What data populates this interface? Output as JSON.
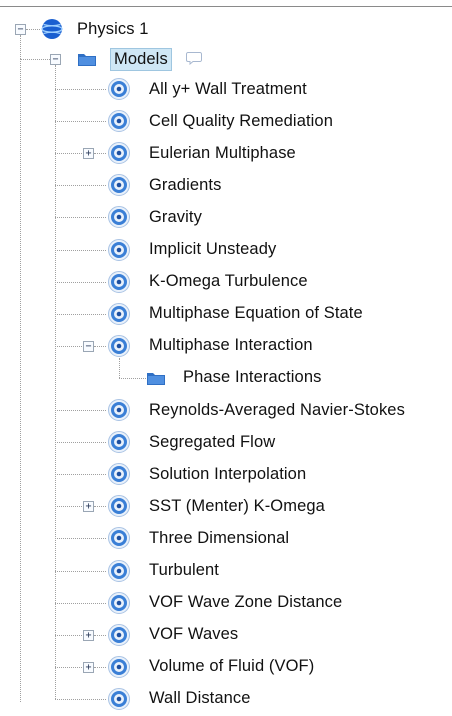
{
  "tree": {
    "root": {
      "label": "Physics 1",
      "icon": "sphere-icon",
      "expanded": true
    },
    "models": {
      "label": "Models",
      "icon": "folder-icon",
      "expanded": true,
      "comment_icon": "comment-bubble-icon"
    },
    "items": [
      {
        "label": "All y+ Wall Treatment",
        "expandable": false
      },
      {
        "label": "Cell Quality Remediation",
        "expandable": false
      },
      {
        "label": "Eulerian Multiphase",
        "expandable": true,
        "expanded": false
      },
      {
        "label": "Gradients",
        "expandable": false
      },
      {
        "label": "Gravity",
        "expandable": false
      },
      {
        "label": "Implicit Unsteady",
        "expandable": false
      },
      {
        "label": "K-Omega Turbulence",
        "expandable": false
      },
      {
        "label": "Multiphase Equation of State",
        "expandable": false
      },
      {
        "label": "Multiphase Interaction",
        "expandable": true,
        "expanded": true,
        "children": [
          {
            "label": "Phase Interactions",
            "icon": "folder-icon"
          }
        ]
      },
      {
        "label": "Reynolds-Averaged Navier-Stokes",
        "expandable": false
      },
      {
        "label": "Segregated Flow",
        "expandable": false
      },
      {
        "label": "Solution Interpolation",
        "expandable": false
      },
      {
        "label": "SST (Menter) K-Omega",
        "expandable": true,
        "expanded": false
      },
      {
        "label": "Three Dimensional",
        "expandable": false
      },
      {
        "label": "Turbulent",
        "expandable": false
      },
      {
        "label": "VOF Wave Zone Distance",
        "expandable": false
      },
      {
        "label": "VOF Waves",
        "expandable": true,
        "expanded": false
      },
      {
        "label": "Volume of Fluid (VOF)",
        "expandable": true,
        "expanded": false
      },
      {
        "label": "Wall Distance",
        "expandable": false
      }
    ],
    "model_icon": "model-node-icon",
    "colors": {
      "selection_bg": "#cfe7f5",
      "folder": "#2f6fc4",
      "sphere": "#1a5fd0",
      "node_ring": "#3a7fd6"
    }
  }
}
